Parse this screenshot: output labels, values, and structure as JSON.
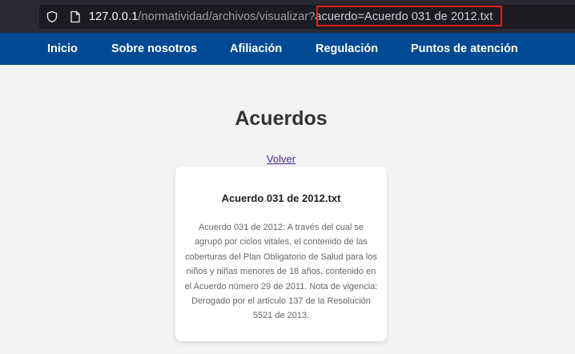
{
  "browser": {
    "url_host": "127.0.0.1",
    "url_path": "/normatividad/archivos/visualizar?",
    "url_query": "acuerdo=Acuerdo 031 de 2012.txt"
  },
  "nav": {
    "items": [
      "Inicio",
      "Sobre nosotros",
      "Afiliación",
      "Regulación",
      "Puntos de atención"
    ]
  },
  "main": {
    "title": "Acuerdos",
    "back_label": "Volver",
    "card": {
      "title": "Acuerdo 031 de 2012.txt",
      "body": "Acuerdo 031 de 2012: A través del cual se agrupó por ciclos vitales, el contenido de las coberturas del Plan Obligatorio de Salud para los niños y niñas menores de 18 años, contenido en el Acuerdo número 29 de 2011. Nota de vigencia: Derogado por el artículo 137 de la Resolución 5521 de 2013."
    }
  },
  "colors": {
    "nav_bg": "#004a94",
    "highlight": "#e0201c",
    "page_bg": "#f3f3f3"
  }
}
